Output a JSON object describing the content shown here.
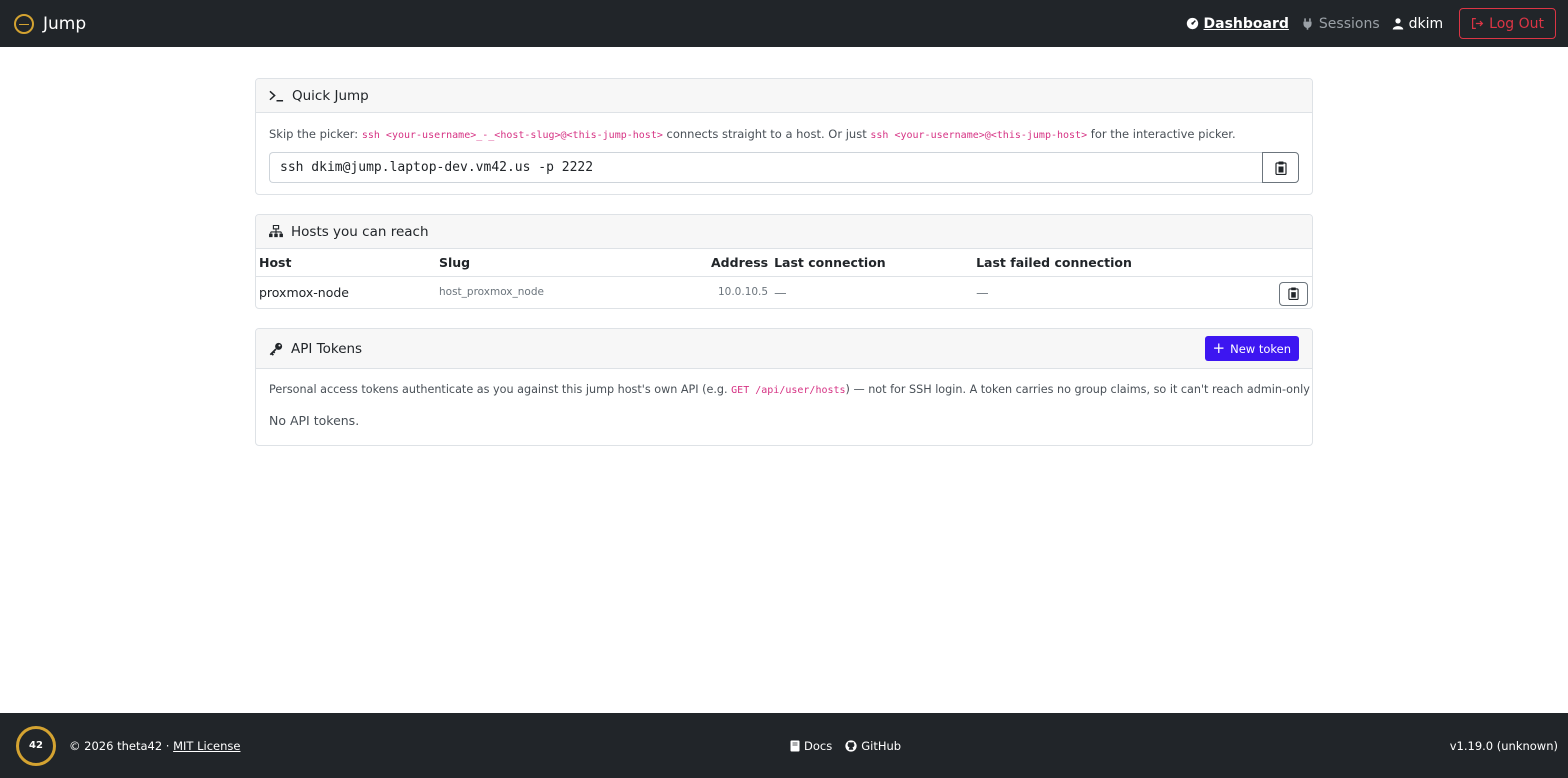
{
  "navbar": {
    "brand": "Jump",
    "links": {
      "dashboard": "Dashboard",
      "sessions": "Sessions",
      "user": "dkim"
    },
    "logout": "Log Out"
  },
  "quick_jump": {
    "title": "Quick Jump",
    "desc_prefix": "Skip the picker: ",
    "code1": "ssh <your-username>_-_<host-slug>@<this-jump-host>",
    "desc_middle": " connects straight to a host. Or just ",
    "code2": "ssh <your-username>@<this-jump-host>",
    "desc_suffix": " for the interactive picker.",
    "command": "ssh dkim@jump.laptop-dev.vm42.us -p 2222"
  },
  "hosts": {
    "title": "Hosts you can reach",
    "columns": {
      "host": "Host",
      "slug": "Slug",
      "address": "Address",
      "last_connection": "Last connection",
      "last_failed": "Last failed connection"
    },
    "rows": [
      {
        "host": "proxmox-node",
        "slug": "host_proxmox_node",
        "address": "10.0.10.5",
        "last_connection": "—",
        "last_failed": "—"
      }
    ]
  },
  "api_tokens": {
    "title": "API Tokens",
    "new_button": "New token",
    "desc_prefix": "Personal access tokens authenticate as you against this jump host's own API (e.g. ",
    "code": "GET /api/user/hosts",
    "desc_suffix": ") — not for SSH login. A token carries no group claims, so it can't reach admin-only endpoints.",
    "empty": "No API tokens."
  },
  "footer": {
    "logo_text": "42",
    "copyright": "© 2026 theta42 · ",
    "license": "MIT License",
    "docs": "Docs",
    "github": "GitHub",
    "version": "v1.19.0 (unknown)"
  },
  "colors": {
    "navbar_bg": "#212529",
    "accent_gold": "#d4a331",
    "danger": "#dc3545",
    "primary": "#3d16f1",
    "code_pink": "#d63384"
  }
}
